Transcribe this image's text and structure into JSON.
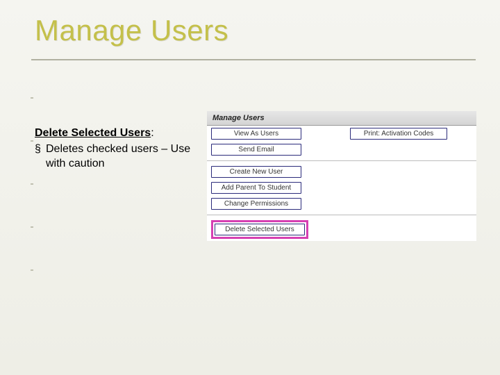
{
  "slide": {
    "title": "Manage Users"
  },
  "description": {
    "heading": "Delete Selected Users",
    "colon": ":",
    "bullet": "Deletes checked users – Use with caution"
  },
  "panel": {
    "header": "Manage Users",
    "buttons": {
      "view_as_users": "View As Users",
      "send_email": "Send Email",
      "create_new_user": "Create New User",
      "add_parent": "Add Parent To Student",
      "change_permissions": "Change Permissions",
      "delete_selected": "Delete Selected Users",
      "print_activation": "Print: Activation Codes"
    }
  }
}
